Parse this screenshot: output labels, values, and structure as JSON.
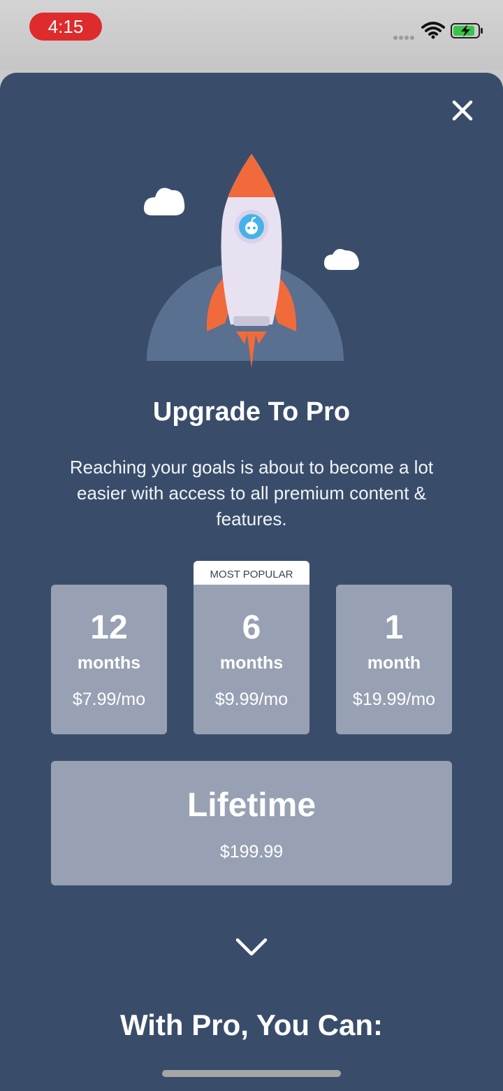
{
  "status_bar": {
    "time": "4:15",
    "icons": [
      "signal-dots-icon",
      "wifi-icon",
      "battery-charging-icon"
    ]
  },
  "modal": {
    "close_icon": "close-icon",
    "illustration": "rocket-illustration",
    "title": "Upgrade To Pro",
    "subtitle": "Reaching your goals is about to become a lot easier with access to all premium content & features.",
    "badge": "MOST POPULAR",
    "plans": [
      {
        "number": "12",
        "unit": "months",
        "price": "$7.99/mo"
      },
      {
        "number": "6",
        "unit": "months",
        "price": "$9.99/mo"
      },
      {
        "number": "1",
        "unit": "month",
        "price": "$19.99/mo"
      }
    ],
    "lifetime": {
      "label": "Lifetime",
      "price": "$199.99"
    },
    "scroll_icon": "chevron-down-icon",
    "section_heading": "With Pro, You Can:"
  },
  "colors": {
    "background": "#394d6b",
    "card": "#97a1b3",
    "accent": "#f06a3c",
    "time_pill": "#de2b2b"
  }
}
